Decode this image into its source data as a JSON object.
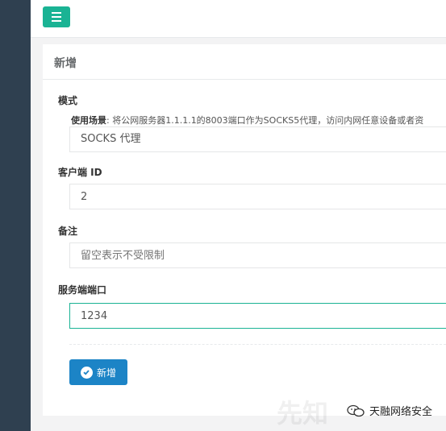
{
  "header": {
    "menu_label": ""
  },
  "form": {
    "title": "新增",
    "mode_label": "模式",
    "usage_prefix": "使用场景",
    "usage_text": ": 将公网服务器1.1.1.1的8003端口作为SOCKS5代理，访问内网任意设备或者资",
    "mode_value": "SOCKS 代理",
    "client_id_label": "客户端 ID",
    "client_id_value": "2",
    "remark_label": "备注",
    "remark_placeholder": "留空表示不受限制",
    "server_port_label": "服务端端口",
    "server_port_value": "1234",
    "submit_label": "新增"
  },
  "watermark": {
    "text": "天融网络安全",
    "logo_text": "先知"
  },
  "colors": {
    "primary": "#1ab394",
    "button": "#1c84c6",
    "sidebar": "#2f4050"
  }
}
